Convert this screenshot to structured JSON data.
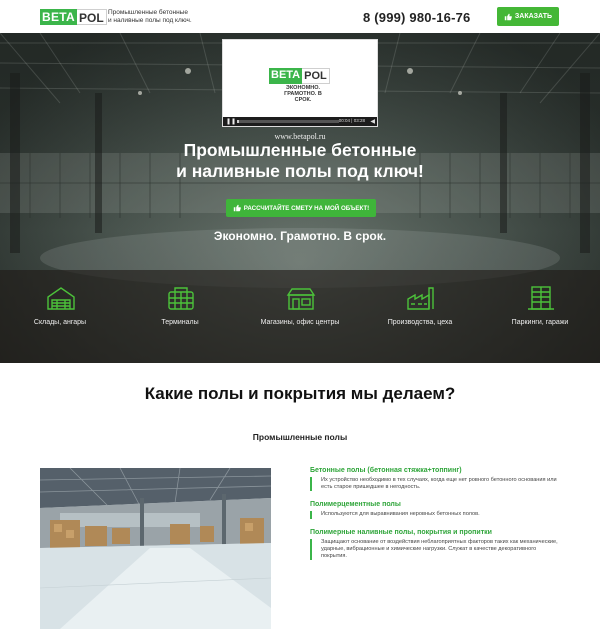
{
  "header": {
    "logo_part1": "BETA",
    "logo_part2": "POL",
    "tagline_line1": "Промышленные бетонные",
    "tagline_line2": "и наливные полы под ключ.",
    "phone": "8 (999) 980-16-76",
    "order_label": "ЗАКАЗАТЬ"
  },
  "hero": {
    "video": {
      "logo_part1": "BETA",
      "logo_part2": "POL",
      "slogan_line1": "ЭКОНОМНО.",
      "slogan_line2": "ГРАМОТНО. В СРОК.",
      "time": "00:04 | 03:28",
      "progress": 0.02
    },
    "url": "www.betapol.ru",
    "title_line1": "Промышленные бетонные",
    "title_line2": "и наливные полы под ключ!",
    "cta_label": "РАССЧИТАЙТЕ СМЕТУ НА МОЙ ОБЪЕКТ!",
    "subtitle": "Экономно. Грамотно. В срок."
  },
  "categories": [
    {
      "label": "Склады, ангары",
      "icon": "hangar-icon"
    },
    {
      "label": "Терминалы",
      "icon": "terminal-icon"
    },
    {
      "label": "Магазины, офис центры",
      "icon": "store-icon"
    },
    {
      "label": "Производства, цеха",
      "icon": "factory-icon"
    },
    {
      "label": "Паркинги, гаражи",
      "icon": "parking-icon"
    }
  ],
  "section": {
    "title": "Какие полы и покрытия мы делаем?",
    "subtitle": "Промышленные полы"
  },
  "floor_types": [
    {
      "title": "Бетонные полы (бетонная стяжка+топпинг)",
      "description": "Их устройство необходимо в тех случаях, когда еще нет ровного бетонного основания или есть старое пришедшее в негодность."
    },
    {
      "title": "Полимерцементные полы",
      "description": "Используются для выравнивания неровных бетонных полов."
    },
    {
      "title": "Полимерные наливные полы, покрытия и пропитки",
      "description": "Защищают основание от воздействия неблагоприятных факторов таких как механические, ударные, вибрационные и химические нагрузки. Служат в качестве декоративного покрытия."
    }
  ],
  "colors": {
    "accent": "#3bb54a",
    "button": "#44b736",
    "icon_green": "#4cc23a"
  }
}
